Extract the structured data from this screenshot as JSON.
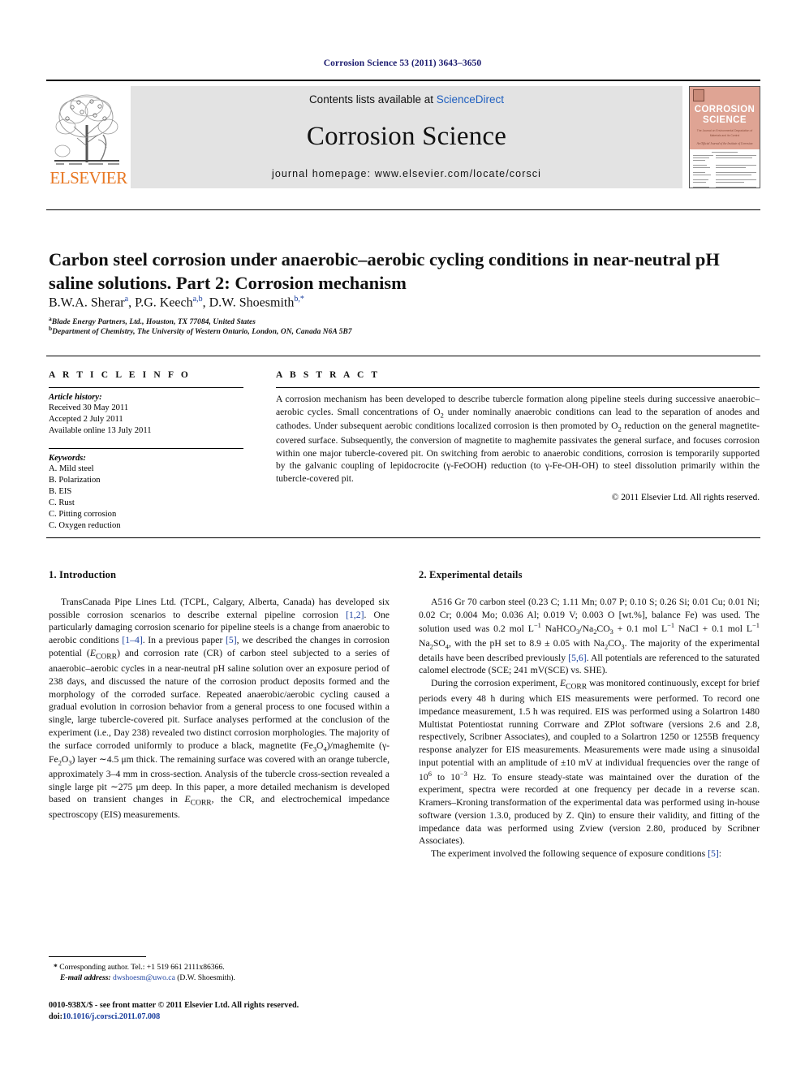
{
  "running_head": "Corrosion Science 53 (2011) 3643–3650",
  "masthead": {
    "publisher_name": "ELSEVIER",
    "contents_prefix": "Contents lists available at ",
    "contents_link": "ScienceDirect",
    "journal_title": "Corrosion Science",
    "homepage": "journal homepage: www.elsevier.com/locate/corsci",
    "cover": {
      "line1": "CORROSION",
      "line2": "SCIENCE",
      "subtitle": "The Journal on Environmental Degradation of Materials and its Control",
      "society": "An Official Journal of the Institute of Corrosion"
    }
  },
  "article": {
    "title": "Carbon steel corrosion under anaerobic–aerobic cycling conditions in near-neutral pH saline solutions. Part 2: Corrosion mechanism",
    "authors": [
      {
        "name": "B.W.A. Sherar",
        "marks": "a"
      },
      {
        "name": "P.G. Keech",
        "marks": "a,b"
      },
      {
        "name": "D.W. Shoesmith",
        "marks": "b,",
        "star": "*"
      }
    ],
    "affiliations": [
      {
        "mark": "a",
        "text": "Blade Energy Partners, Ltd., Houston, TX 77084, United States"
      },
      {
        "mark": "b",
        "text": "Department of Chemistry, The University of Western Ontario, London, ON, Canada N6A 5B7"
      }
    ]
  },
  "article_info": {
    "heading": "A R T I C L E    I N F O",
    "history_label": "Article history:",
    "history": [
      "Received 30 May 2011",
      "Accepted 2 July 2011",
      "Available online 13 July 2011"
    ],
    "keywords_label": "Keywords:",
    "keywords": [
      "A. Mild steel",
      "B. Polarization",
      "B. EIS",
      "C. Rust",
      "C. Pitting corrosion",
      "C. Oxygen reduction"
    ]
  },
  "abstract": {
    "heading": "A B S T R A C T",
    "copyright": "© 2011 Elsevier Ltd. All rights reserved."
  },
  "sections": {
    "intro_heading": "1. Introduction",
    "experimental_heading": "2. Experimental details"
  },
  "footnote": {
    "star": "*",
    "corresponding": "Corresponding author. Tel.: +1 519 661 2111x86366.",
    "email_label": "E-mail address:",
    "email": "dwshoesm@uwo.ca",
    "email_owner": "(D.W. Shoesmith)."
  },
  "footer": {
    "line1": "0010-938X/$ - see front matter © 2011 Elsevier Ltd. All rights reserved.",
    "doi_label": "doi:",
    "doi": "10.1016/j.corsci.2011.07.008"
  },
  "colors": {
    "link": "#1a3f9e",
    "elsevier_orange": "#E87722",
    "band_gray": "#e3e3e3",
    "cover_salmon": "#dfa494"
  }
}
